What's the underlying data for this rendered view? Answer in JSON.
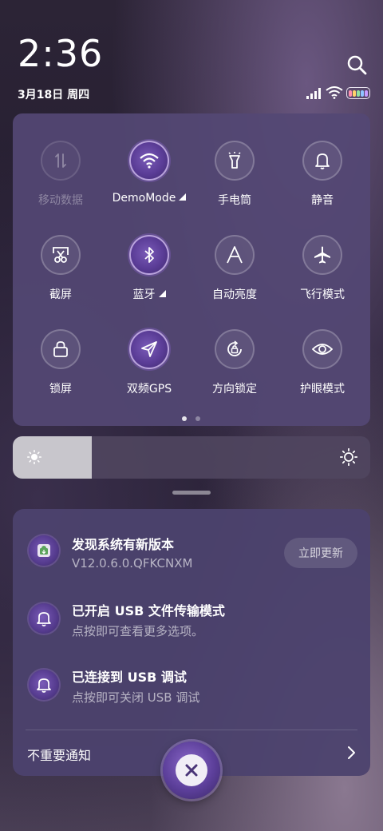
{
  "status": {
    "time": "2:36",
    "date": "3月18日 周四"
  },
  "quick_settings": {
    "tiles": [
      {
        "label": "移动数据",
        "icon": "mobile-data-icon",
        "state": "disabled"
      },
      {
        "label": "DemoMode",
        "icon": "wifi-icon",
        "state": "active",
        "expand": true
      },
      {
        "label": "手电筒",
        "icon": "flashlight-icon",
        "state": "off"
      },
      {
        "label": "静音",
        "icon": "bell-icon",
        "state": "off"
      },
      {
        "label": "截屏",
        "icon": "screenshot-icon",
        "state": "off"
      },
      {
        "label": "蓝牙",
        "icon": "bluetooth-icon",
        "state": "active",
        "expand": true
      },
      {
        "label": "自动亮度",
        "icon": "auto-brightness-icon",
        "state": "off"
      },
      {
        "label": "飞行模式",
        "icon": "airplane-icon",
        "state": "off"
      },
      {
        "label": "锁屏",
        "icon": "lock-icon",
        "state": "off"
      },
      {
        "label": "双频GPS",
        "icon": "gps-icon",
        "state": "active"
      },
      {
        "label": "方向锁定",
        "icon": "rotation-lock-icon",
        "state": "off"
      },
      {
        "label": "护眼模式",
        "icon": "eye-icon",
        "state": "off"
      }
    ],
    "page_count": 2,
    "current_page": 1
  },
  "brightness": {
    "level": 0.22
  },
  "notifications": [
    {
      "title": "发现系统有新版本",
      "subtitle": "V12.0.6.0.QFKCNXM",
      "icon": "android-update-icon",
      "action": "立即更新"
    },
    {
      "title": "已开启 USB 文件传输模式",
      "subtitle": "点按即可查看更多选项。",
      "icon": "bell-icon"
    },
    {
      "title": "已连接到 USB 调试",
      "subtitle": "点按即可关闭 USB 调试",
      "icon": "bell-icon"
    }
  ],
  "footer": {
    "unimportant_label": "不重要通知"
  },
  "colors": {
    "panel": "#54487a",
    "accent": "#6a4ca8"
  }
}
